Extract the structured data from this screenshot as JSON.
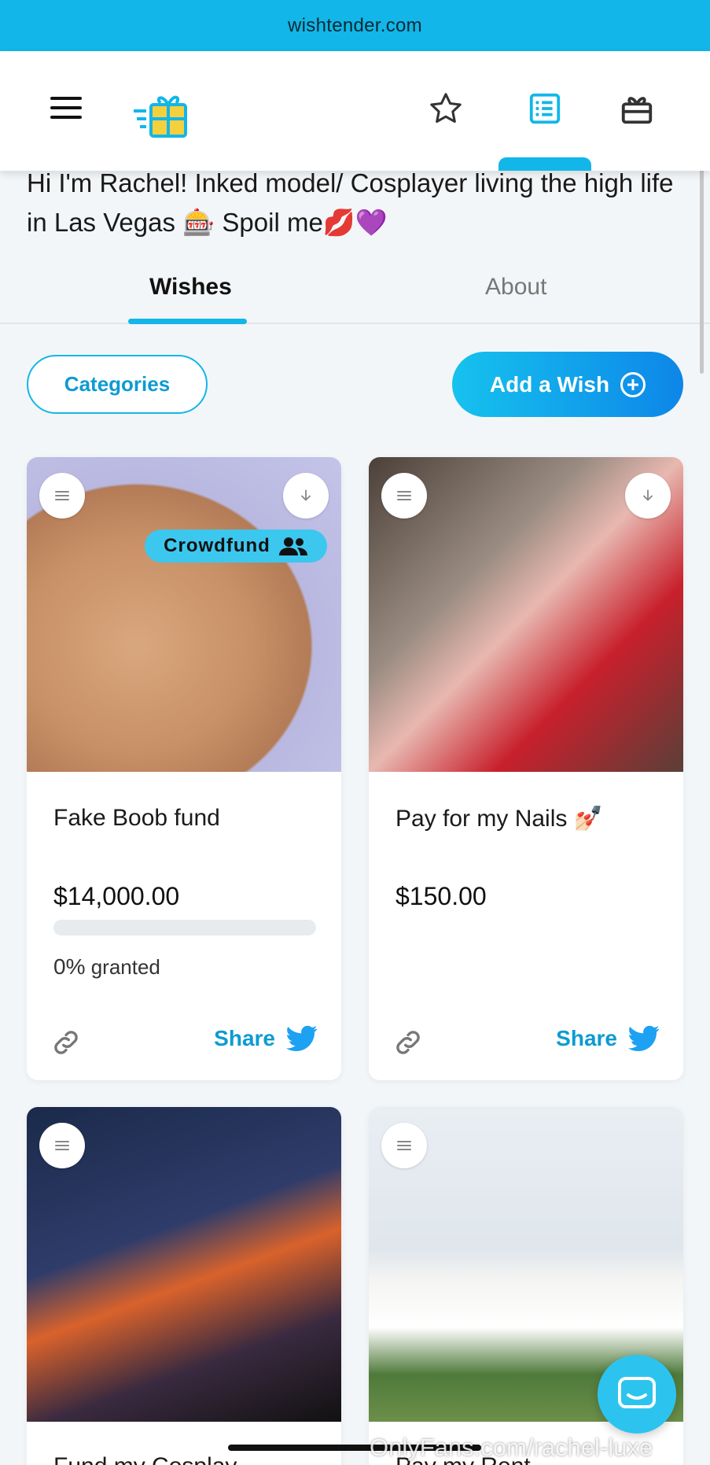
{
  "browser": {
    "url": "wishtender.com"
  },
  "nav": {
    "menu_icon": "hamburger-icon",
    "logo_icon": "gift-logo-icon",
    "icons": [
      "star-icon",
      "list-icon",
      "gift-icon"
    ],
    "active_icon": "list-icon",
    "accent": "#12b6e8"
  },
  "profile": {
    "bio": "Hi I'm Rachel! Inked model/ Cosplayer living the high life in Las Vegas 🎰 Spoil me💋💜"
  },
  "tabs": [
    {
      "label": "Wishes",
      "active": true
    },
    {
      "label": "About",
      "active": false
    }
  ],
  "actions": {
    "categories_label": "Categories",
    "add_wish_label": "Add a Wish"
  },
  "wishes": [
    {
      "title": "Fake Boob fund",
      "price": "$14,000.00",
      "badge": "Crowdfund",
      "progress_percent": 0,
      "percent_text": "0%",
      "granted_text": "granted",
      "share_label": "Share"
    },
    {
      "title": "Pay for my Nails 💅🏻",
      "price": "$150.00",
      "share_label": "Share"
    }
  ],
  "partial_titles": [
    "Fund my Cosplay",
    "Pay my Rent"
  ],
  "watermark": "OnlyFans.com/rachel-luxe",
  "colors": {
    "brand": "#12b6e8",
    "twitter": "#1da1f2"
  }
}
